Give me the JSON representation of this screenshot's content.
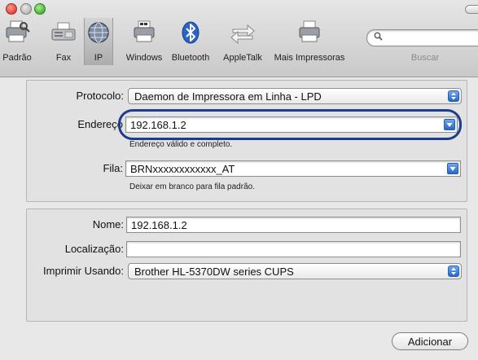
{
  "toolbar": {
    "items": [
      {
        "label": "Padrão",
        "icon": "default-printers-icon"
      },
      {
        "label": "Fax",
        "icon": "fax-icon"
      },
      {
        "label": "IP",
        "icon": "ip-globe-icon",
        "selected": true
      },
      {
        "label": "Windows",
        "icon": "windows-printer-icon"
      },
      {
        "label": "Bluetooth",
        "icon": "bluetooth-icon"
      },
      {
        "label": "AppleTalk",
        "icon": "appletalk-icon"
      },
      {
        "label": "Mais Impressoras",
        "icon": "more-printers-icon"
      }
    ],
    "search_label": "Buscar"
  },
  "ip_settings": {
    "protocol_label": "Protocolo:",
    "protocol_value": "Daemon de Impressora em Linha - LPD",
    "address_label": "Endereço",
    "address_value": "192.168.1.2",
    "address_hint": "Endereço válido e completo.",
    "queue_label": "Fila:",
    "queue_value": "BRNxxxxxxxxxxxx_AT",
    "queue_hint": "Deixar em branco para fila padrão."
  },
  "printer_info": {
    "name_label": "Nome:",
    "name_value": "192.168.1.2",
    "location_label": "Localização:",
    "location_value": "",
    "print_using_label": "Imprimir Usando:",
    "print_using_value": "Brother HL-5370DW series CUPS"
  },
  "actions": {
    "add_label": "Adicionar"
  },
  "colors": {
    "highlight_border": "#1f3c8c",
    "popup_arrow": "#2a66c7"
  }
}
